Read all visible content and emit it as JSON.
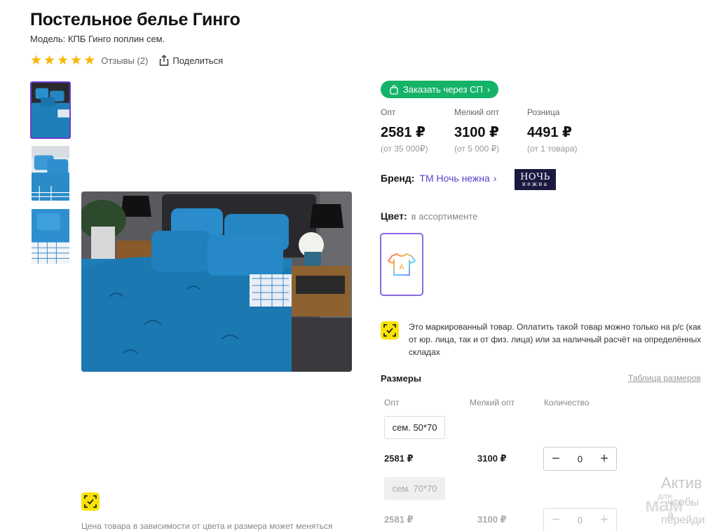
{
  "product": {
    "title": "Постельное белье Гинго",
    "model": "Модель: КПБ Гинго поплин сем.",
    "rating_stars": 5,
    "reviews": "Отзывы (2)",
    "share": "Поделиться"
  },
  "order_button": "Заказать через СП",
  "prices": [
    {
      "label": "Опт",
      "value": "2581 ₽",
      "sub": "(от 35 000₽)"
    },
    {
      "label": "Мелкий опт",
      "value": "3100 ₽",
      "sub": "(от 5 000 ₽)"
    },
    {
      "label": "Розница",
      "value": "4491 ₽",
      "sub": "(от 1 товара)"
    }
  ],
  "brand": {
    "label": "Бренд:",
    "name": "ТМ Ночь нежна",
    "logo_line1": "НОЧЬ",
    "logo_line2": "нежна"
  },
  "color": {
    "label": "Цвет:",
    "value": "в ассортименте"
  },
  "marking_notice": "Это маркированный товар. Оплатить такой товар можно только на р/с (как от юр. лица, так и от физ. лица) или за наличный расчёт на определённых складах",
  "sizes": {
    "title": "Размеры",
    "table_link": "Таблица размеров",
    "headers": [
      "Опт",
      "Мелкий опт",
      "Количество"
    ],
    "rows": [
      {
        "size": "сем. 50*70",
        "opt": "2581 ₽",
        "small_opt": "3100 ₽",
        "qty": "0"
      },
      {
        "size": "сем. 70*70",
        "opt": "2581 ₽",
        "small_opt": "3100 ₽",
        "qty": "0"
      }
    ]
  },
  "price_note": "Цена товара в зависимости от цвета и размера может меняться",
  "overlay": {
    "activate": "Актив",
    "line2": "чтобы а",
    "line3": "перейди",
    "watermark": "мам",
    "watermark_small": "для"
  },
  "colors": {
    "accent": "#6a3dd1",
    "green": "#14b368",
    "star": "#f5b800",
    "marking_yellow": "#f8e300",
    "bedding_blue": "#1f7fb8"
  }
}
